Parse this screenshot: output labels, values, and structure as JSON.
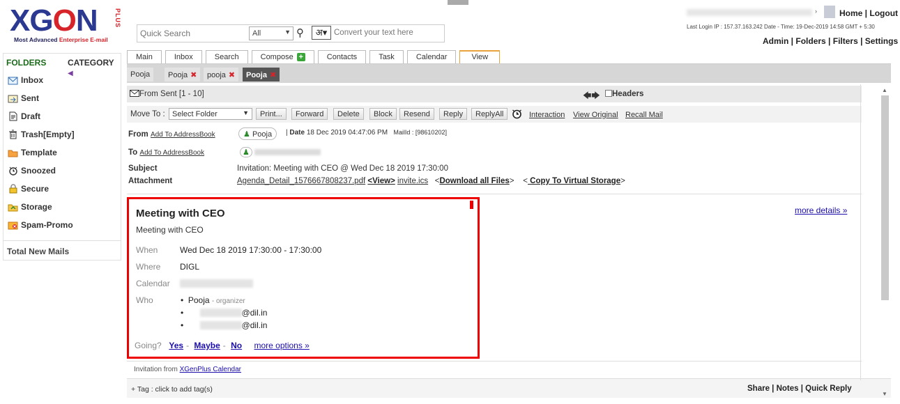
{
  "logo": {
    "brand_left": "XG",
    "brand_o": "O",
    "brand_right": "N",
    "plus": "PLUS",
    "tagline_a": "Most Advanced ",
    "tagline_b": "Enterprise",
    "tagline_c": " E-mail"
  },
  "search": {
    "placeholder": "Quick Search",
    "scope": "All",
    "hindi": "अ",
    "convert_placeholder": "Convert your text here"
  },
  "header": {
    "home": "Home",
    "logout": "Logout",
    "last_login": "Last Login IP : 157.37.163.242 Date - Time: 19-Dec-2019 14:58 GMT + 5:30",
    "admin": "Admin",
    "folders": "Folders",
    "filters": "Filters",
    "settings": "Settings"
  },
  "tabs": [
    "Main",
    "Inbox",
    "Search",
    "Compose",
    "Contacts",
    "Task",
    "Calendar",
    "View"
  ],
  "subtabs": [
    "Pooja",
    "Pooja",
    "pooja",
    "Pooja"
  ],
  "sidebar": {
    "folders_label": "FOLDERS",
    "category_label": "CATEGORY",
    "items": [
      "Inbox",
      "Sent",
      "Draft",
      "Trash[Empty]",
      "Template",
      "Snoozed",
      "Secure",
      "Storage",
      "Spam-Promo"
    ],
    "total_label": "Total New Mails"
  },
  "mail": {
    "from_bar": "From  Sent [1 - 10]",
    "headers_label": "Headers",
    "move_to_label": "Move To :",
    "select_folder": "Select Folder",
    "buttons": [
      "Print...",
      "Forward",
      "Delete",
      "Block",
      "Resend",
      "Reply",
      "ReplyAll"
    ],
    "links": [
      "Interaction",
      "View Original",
      "Recall Mail"
    ],
    "from_key": "From",
    "to_key": "To",
    "add_to_ab": "Add To AddressBook",
    "from_name": "Pooja",
    "date_label": "Date",
    "date_value": "18 Dec 2019 04:47:06 PM",
    "mailid": "MailId : [98610202]",
    "subject_key": "Subject",
    "subject_value": "Invitation: Meeting with CEO @ Wed Dec 18 2019 17:30:00",
    "attachment_key": "Attachment",
    "attachment_file": "Agenda_Detail_1576667808237.pdf",
    "attachment_view": "<View>",
    "attachment_ics": "invite.ics",
    "download_all": "Download all Files",
    "copy_storage": " Copy To Virtual Storage"
  },
  "invite": {
    "title": "Meeting with CEO",
    "subtitle": "Meeting with CEO",
    "when_k": "When",
    "when_v": "Wed Dec 18 2019 17:30:00 - 17:30:00",
    "where_k": "Where",
    "where_v": "DIGL",
    "calendar_k": "Calendar",
    "who_k": "Who",
    "organizer_name": "Pooja",
    "organizer_tag": "- organizer",
    "guest1_tail": "@dil.in",
    "guest2_tail": "@dil.in",
    "going": "Going?",
    "yes": "Yes",
    "maybe": "Maybe",
    "no": "No",
    "more_options": "more options »",
    "more_details": "more details »"
  },
  "footer": {
    "invitation_from": "Invitation from ",
    "invitation_link": "XGenPlus Calendar",
    "tag": "+ Tag : click to add tag(s)",
    "share": "Share",
    "notes": "Notes",
    "quick_reply": "Quick Reply"
  },
  "colors": {
    "brand_blue": "#2b3990",
    "brand_red": "#d7232a",
    "highlight_box": "#e00000",
    "active_tab": "#e8a33d"
  }
}
